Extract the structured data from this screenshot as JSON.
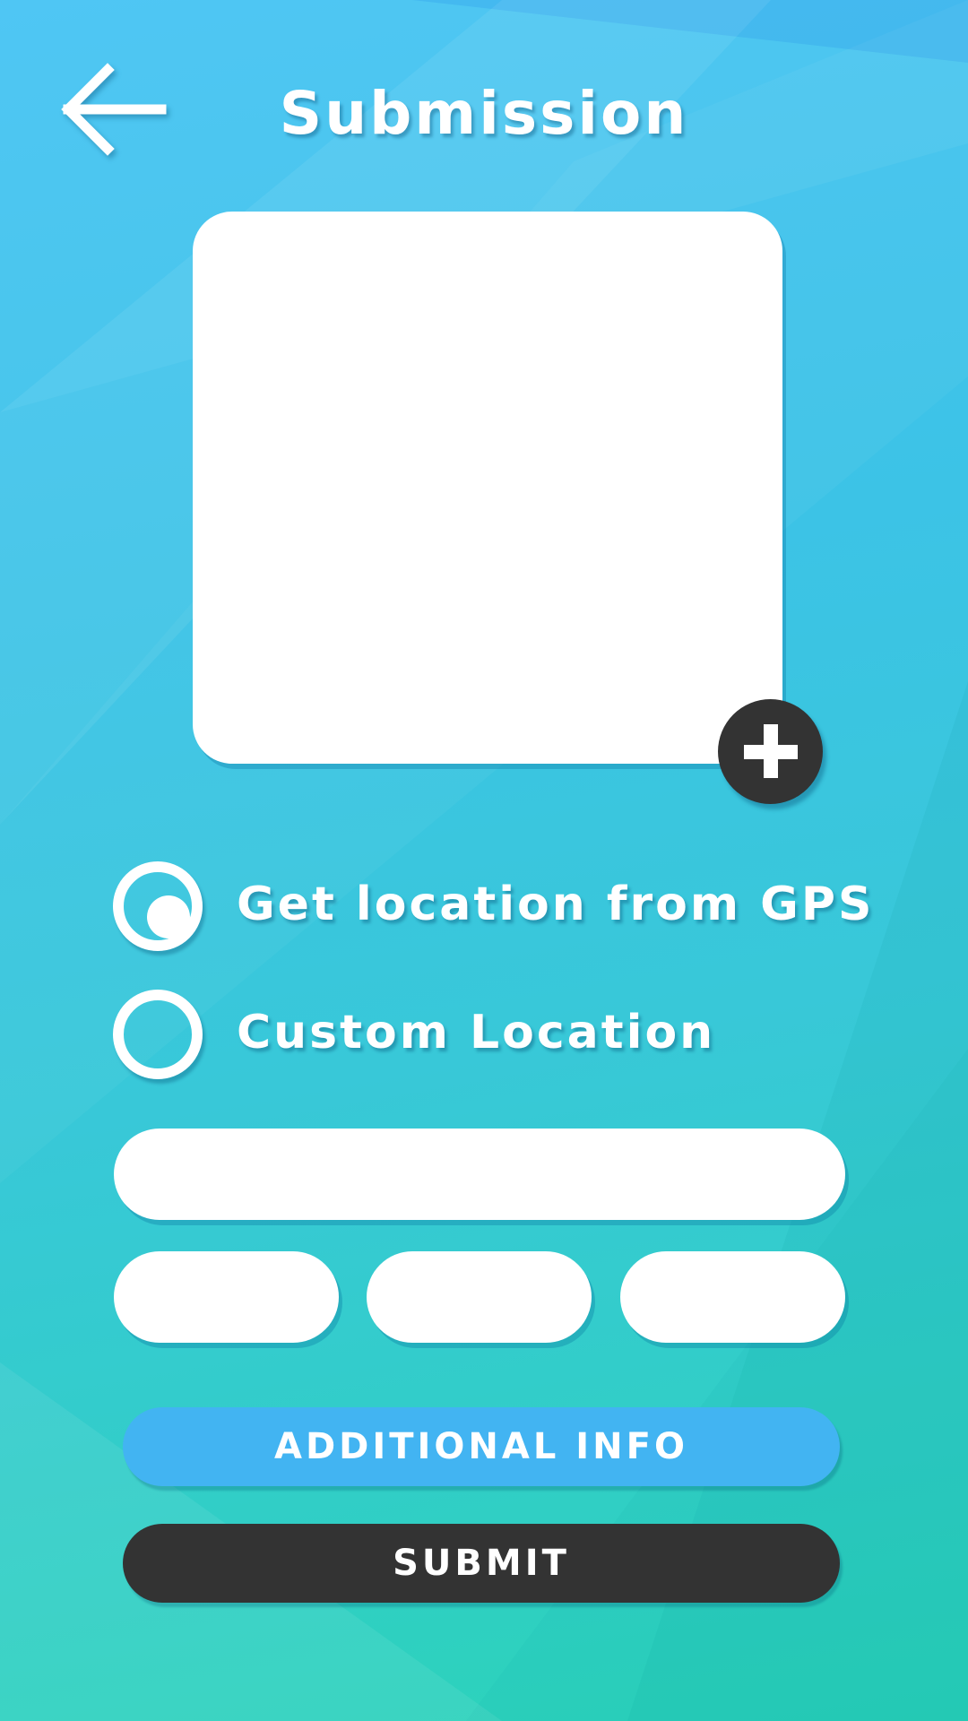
{
  "header": {
    "title": "Submission",
    "back_icon": "arrow-left-icon"
  },
  "photo": {
    "add_icon": "plus-icon"
  },
  "location": {
    "options": [
      {
        "label": "Get location from GPS",
        "selected": true
      },
      {
        "label": "Custom Location",
        "selected": false
      }
    ]
  },
  "fields": {
    "address_value": "",
    "field_1_value": "",
    "field_2_value": "",
    "field_3_value": ""
  },
  "actions": {
    "additional_info_label": "ADDITIONAL INFO",
    "submit_label": "SUBMIT"
  },
  "colors": {
    "background_top": "#46c3f4",
    "background_bottom": "#2bd3b9",
    "additional_info_button": "#42b4f2",
    "submit_button": "#333333",
    "add_button": "#333333"
  }
}
